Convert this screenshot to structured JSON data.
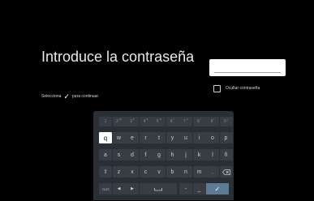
{
  "title": "Introduce la contraseña",
  "password_field": {
    "value": ""
  },
  "hide_password_label": "Ocultar contraseña",
  "hint": {
    "before": "Selecciona",
    "after": "para continuar."
  },
  "keyboard": {
    "num_row": [
      "1",
      "2",
      "3",
      "4",
      "5",
      "6",
      "7",
      "8",
      "9",
      "0"
    ],
    "num_row_sup": [
      "",
      "@",
      "#",
      "$",
      "%",
      "^",
      "&",
      "*",
      "(",
      ")"
    ],
    "row1": [
      "q",
      "w",
      "e",
      "r",
      "t",
      "y",
      "u",
      "i",
      "o",
      "p"
    ],
    "row2": [
      "a",
      "s",
      "d",
      "f",
      "g",
      "h",
      "j",
      "k",
      "l",
      "ñ"
    ],
    "row3": [
      "z",
      "x",
      "c",
      "v",
      "b",
      "n",
      "m",
      "."
    ],
    "focused_key": "q",
    "symbols_label": "?123",
    "prev_label": "◀",
    "next_label": "▶",
    "dash_label": "-",
    "underscore_label": "_"
  },
  "colors": {
    "background": "#000000",
    "keyboard_bg": "#2a2e35",
    "key_bg": "#383c43",
    "enter_key": "#5f7a93"
  }
}
